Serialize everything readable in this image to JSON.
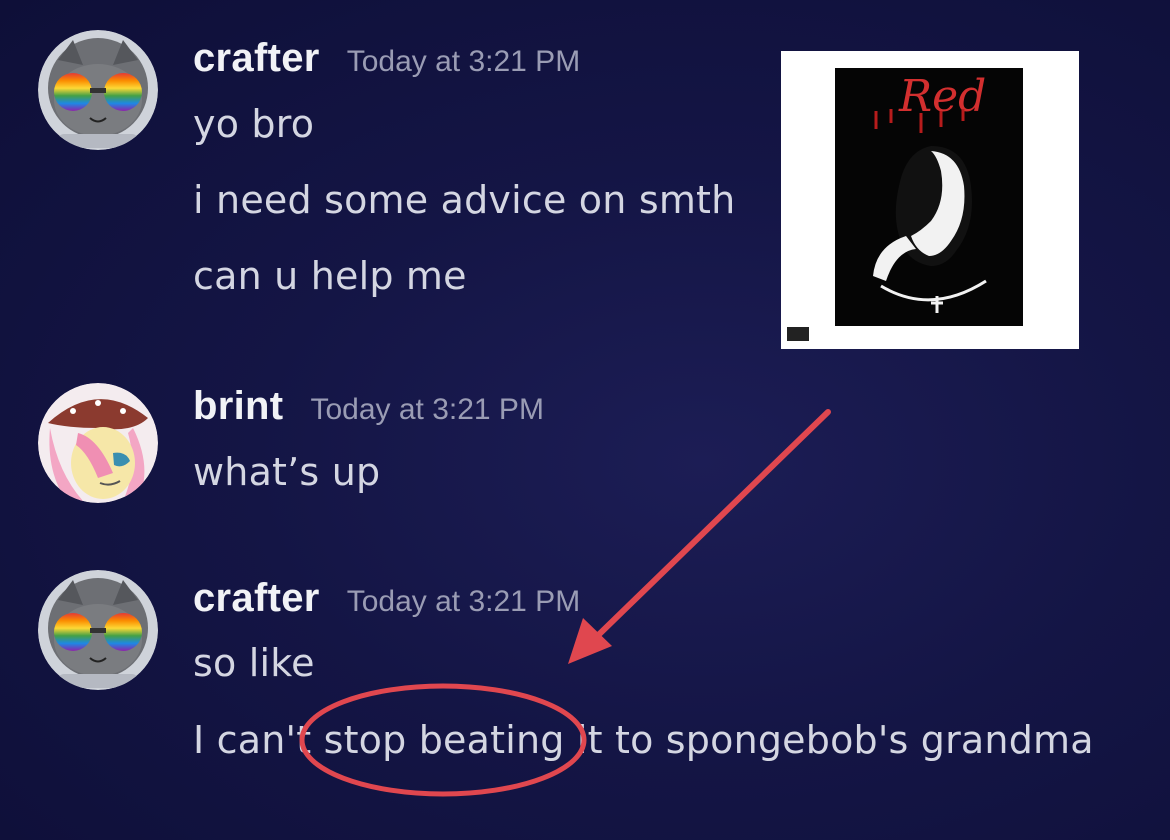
{
  "messages": [
    {
      "author": "crafter",
      "timestamp": "Today at 3:21 PM",
      "avatar": "cat-astronaut-avatar",
      "lines": [
        "yo bro",
        "i need some advice on smth",
        "can u help me"
      ]
    },
    {
      "author": "brint",
      "timestamp": "Today at 3:21 PM",
      "avatar": "pony-avatar",
      "lines": [
        "what’s up"
      ]
    },
    {
      "author": "crafter",
      "timestamp": "Today at 3:21 PM",
      "avatar": "cat-astronaut-avatar",
      "lines": [
        "so like",
        "I can't stop beating it to spongebob's grandma"
      ]
    }
  ],
  "attachment": {
    "title_text": "Red",
    "icon": "album-cover-image"
  },
  "annotation": {
    "circled_text": "stop beating",
    "color": "#e0474f"
  },
  "colors": {
    "background": "#141545",
    "author": "#f1f2f6",
    "timestamp": "#9a9cb4",
    "message": "#d4d6e2"
  }
}
